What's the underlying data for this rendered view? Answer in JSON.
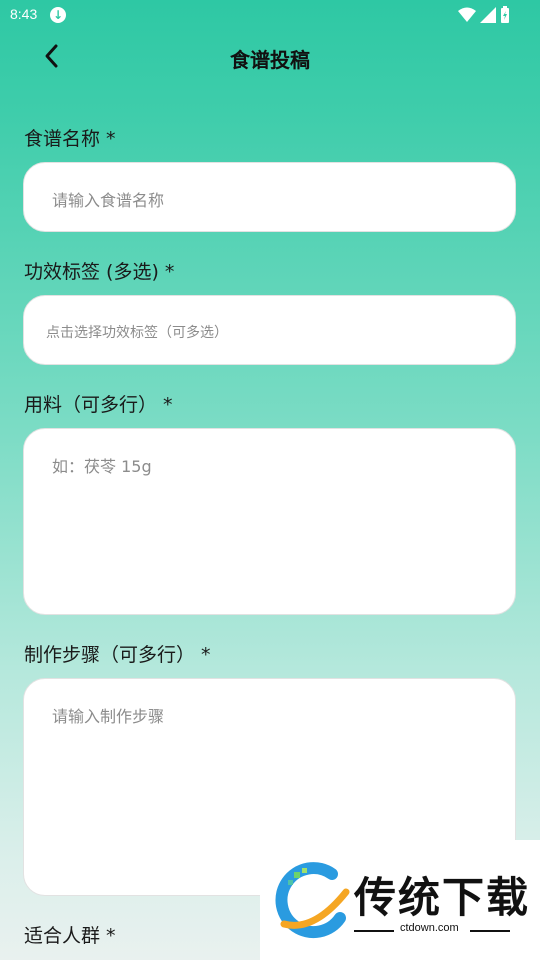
{
  "status": {
    "time": "8:43"
  },
  "header": {
    "title": "食谱投稿"
  },
  "form": {
    "name_label": "食谱名称 *",
    "name_placeholder": "请输入食谱名称",
    "tags_label": "功效标签 (多选) *",
    "tags_placeholder": "点击选择功效标签（可多选）",
    "ingredients_label": "用料（可多行） *",
    "ingredients_placeholder": "如：茯苓 15g",
    "steps_label": "制作步骤（可多行） *",
    "steps_placeholder": "请输入制作步骤",
    "audience_label": "适合人群 *"
  },
  "watermark": {
    "brand": "传统下载",
    "url": "ctdown.com"
  },
  "colors": {
    "accent": "#2ec8a4",
    "field_bg": "#ffffff",
    "placeholder": "#8c8c8c"
  }
}
